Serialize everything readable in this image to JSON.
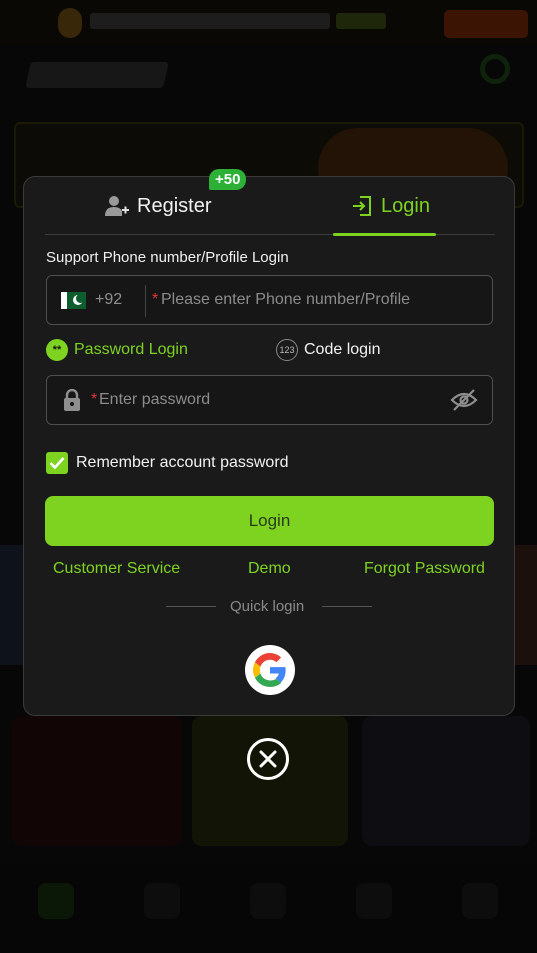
{
  "tabs": {
    "register_label": "Register",
    "register_bonus": "+50",
    "login_label": "Login",
    "active": "login"
  },
  "form": {
    "section_label": "Support Phone number/Profile Login",
    "dial_code": "+92",
    "phone_placeholder": "Please enter Phone number/Profile",
    "required_mark": "*",
    "password_placeholder": "Enter password",
    "mode_password_label": "Password Login",
    "mode_code_label": "Code login",
    "mode_password_icon": "**",
    "mode_code_icon": "123",
    "remember_label": "Remember account password",
    "remember_checked": true
  },
  "actions": {
    "login_label": "Login",
    "customer_service": "Customer Service",
    "demo": "Demo",
    "forgot_password": "Forgot Password"
  },
  "quick_login": {
    "label": "Quick login",
    "providers": [
      "google-icon"
    ]
  },
  "colors": {
    "accent": "#7ed321",
    "badge": "#2db036",
    "required": "#e0363a",
    "modal_bg": "#1a1a1a"
  }
}
